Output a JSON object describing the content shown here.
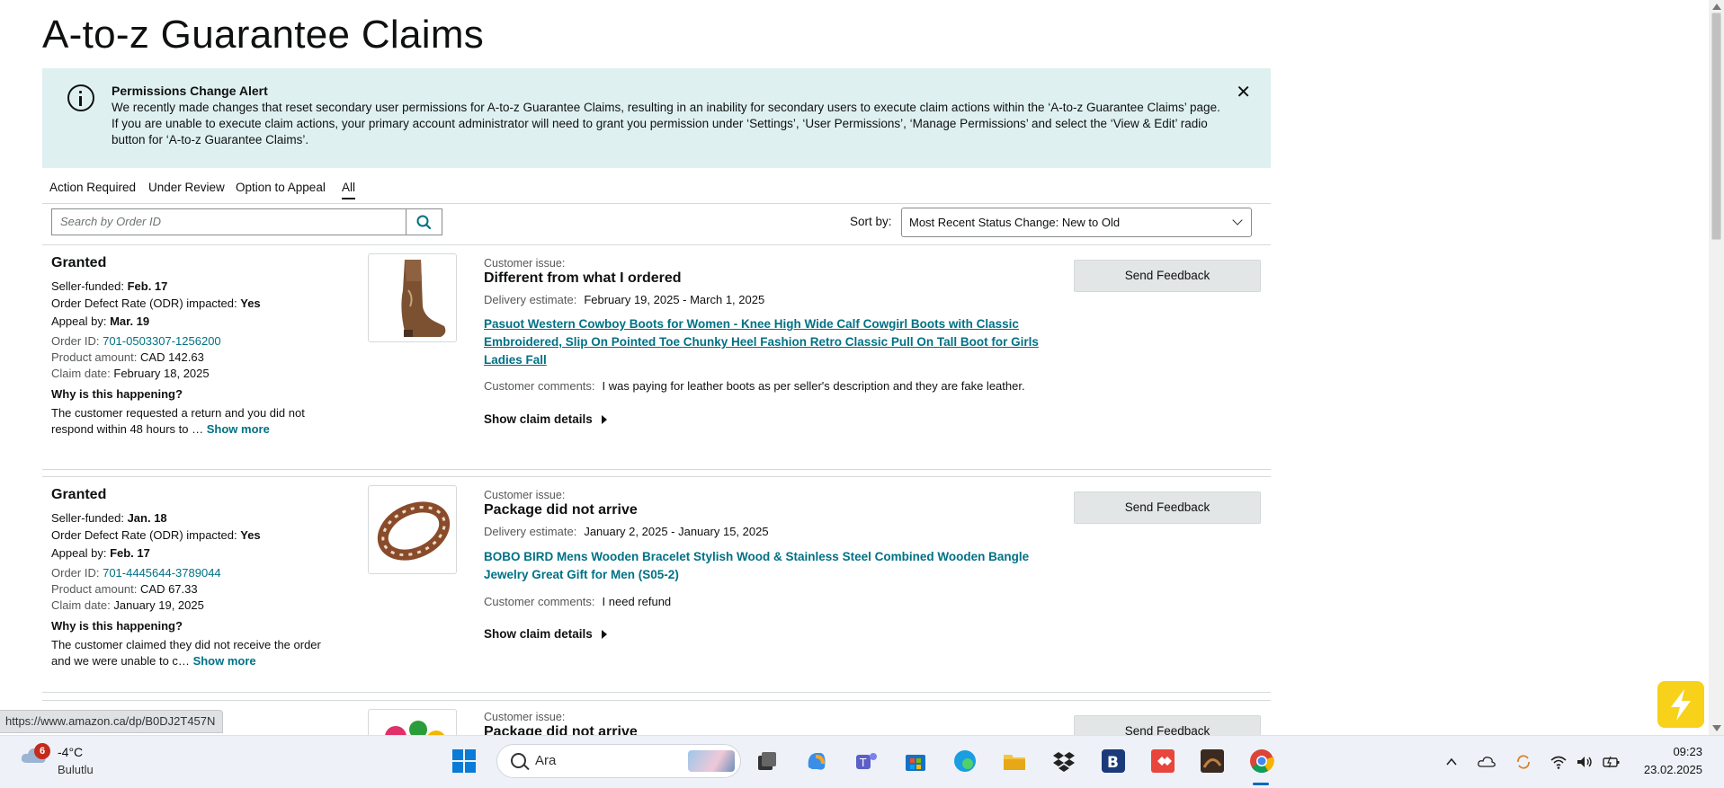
{
  "page": {
    "title": "A-to-z Guarantee Claims",
    "alert": {
      "title": "Permissions Change Alert",
      "body": "We recently made changes that reset secondary user permissions for A-to-z Guarantee Claims, resulting in an inability for secondary users to execute claim actions within the ‘A-to-z Guarantee Claims’ page. If you are unable to execute claim actions, your primary account administrator will need to grant you permission under ‘Settings’, ‘User Permissions’, ‘Manage Permissions’ and select the ‘View & Edit’ radio button for ‘A-to-z Guarantee Claims’.",
      "close": "✕"
    },
    "tabs": [
      "Action Required",
      "Under Review",
      "Option to Appeal",
      "All"
    ],
    "active_tab": "All",
    "search": {
      "placeholder": "Search by Order ID"
    },
    "sort": {
      "label": "Sort by:",
      "value": "Most Recent Status Change: New to Old"
    }
  },
  "labels": {
    "seller_funded": "Seller-funded:",
    "odr": "Order Defect Rate (ODR) impacted:",
    "appeal_by": "Appeal by:",
    "order_id": "Order ID:",
    "product_amount": "Product amount:",
    "claim_date": "Claim date:",
    "why": "Why is this happening?",
    "show_more": "Show more",
    "customer_issue": "Customer issue:",
    "delivery_estimate": "Delivery estimate:",
    "customer_comments": "Customer comments:",
    "show_details": "Show claim details",
    "send_feedback": "Send Feedback"
  },
  "claims": [
    {
      "status": "Granted",
      "seller_funded": "Feb. 17",
      "odr": "Yes",
      "appeal_by": "Mar. 19",
      "order_id": "701-0503307-1256200",
      "product_amount": "CAD 142.63",
      "claim_date": "February 18, 2025",
      "reason": "The customer requested a return and you did not respond within 48 hours to …",
      "issue": "Different from what I ordered",
      "delivery_estimate": "February 19, 2025 - March 1, 2025",
      "product": "Pasuot Western Cowboy Boots for Women - Knee High Wide Calf Cowgirl Boots with Classic Embroidered, Slip On Pointed Toe Chunky Heel Fashion Retro Classic Pull On Tall Boot for Girls Ladies Fall",
      "comments": "I was paying for leather boots as per seller's description and they are fake leather."
    },
    {
      "status": "Granted",
      "seller_funded": "Jan. 18",
      "odr": "Yes",
      "appeal_by": "Feb. 17",
      "order_id": "701-4445644-3789044",
      "product_amount": "CAD 67.33",
      "claim_date": "January 19, 2025",
      "reason": "The customer claimed they did not receive the order and we were unable to c…",
      "issue": "Package did not arrive",
      "delivery_estimate": "January 2, 2025 - January 15, 2025",
      "product": "BOBO BIRD Mens Wooden Bracelet Stylish Wood & Stainless Steel Combined Wooden Bangle Jewelry Great Gift for Men (S05-2)",
      "comments": "I need refund"
    },
    {
      "issue": "Package did not arrive"
    }
  ],
  "browser": {
    "status_url": "https://www.amazon.ca/dp/B0DJ2T457N"
  },
  "taskbar": {
    "weather_badge": "6",
    "temperature": "-4°C",
    "condition": "Bulutlu",
    "search_text": "Ara",
    "time": "09:23",
    "date": "23.02.2025"
  }
}
